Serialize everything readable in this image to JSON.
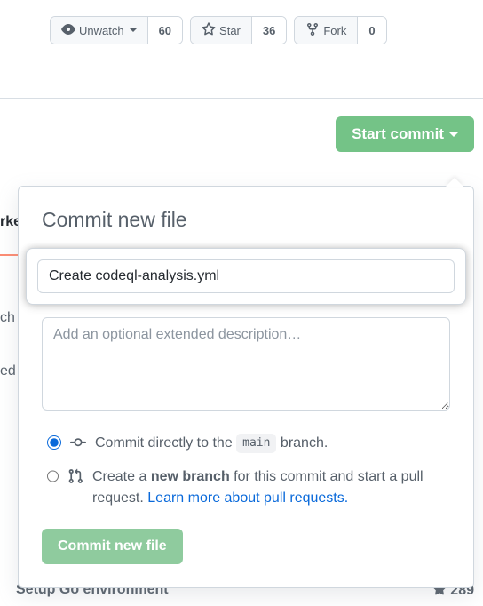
{
  "social": {
    "watch_label": "Unwatch",
    "watch_count": "60",
    "star_label": "Star",
    "star_count": "36",
    "fork_label": "Fork",
    "fork_count": "0"
  },
  "start_commit_label": "Start commit",
  "commit_form": {
    "title": "Commit new file",
    "summary_value": "Create codeql-analysis.yml",
    "description_placeholder": "Add an optional extended description…",
    "option_direct_pre": "Commit directly to the ",
    "option_direct_branch": "main",
    "option_direct_post": " branch.",
    "option_branch_pre": "Create a ",
    "option_branch_bold": "new branch",
    "option_branch_post": " for this commit and start a pull request. ",
    "option_branch_link": "Learn more about pull requests.",
    "commit_button": "Commit new file"
  },
  "bg": {
    "left1": "rke",
    "left2": "ch",
    "left3": "ed",
    "bottom_title": "Setup Go environment",
    "bottom_stars": "289"
  }
}
